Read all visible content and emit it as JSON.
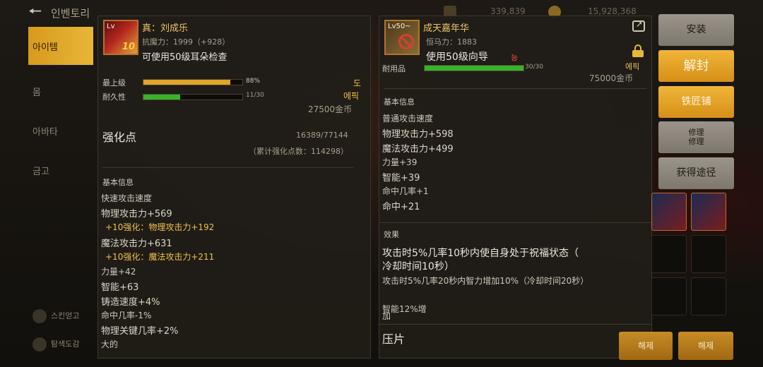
{
  "topbar": {
    "title": "인벤토리",
    "currency_1": "339,839",
    "currency_2": "15,928,368"
  },
  "nav": {
    "items": [
      "아이템",
      "몸",
      "아바타",
      "금고"
    ],
    "bottom_1": "스킨얻고",
    "bottom_2": "탐색도감"
  },
  "left_panel": {
    "item_name": "真：刘成乐",
    "item_level": "Lv",
    "item_plus": "10",
    "magic_resist": "抗魔力：1999（+928）",
    "usage": "可使用50级耳朵检查",
    "grade_label": "最上级",
    "grade_percent": "88%",
    "grade_fill": 0.88,
    "grade_right": "도",
    "durability_label": "耐久性",
    "durability_value": "11/30",
    "durability_fill": 0.37,
    "rarity": "에픽",
    "price": "27500金币",
    "enhance_label": "强化点",
    "enhance_value": "16389/77144",
    "enhance_total": "（累计强化点数：114298）",
    "basic_info_title": "基本信息",
    "stats": [
      {
        "text": "快速攻击速度",
        "cls": "stat-s"
      },
      {
        "text": "物理攻击力+569",
        "cls": "stat"
      },
      {
        "text": "+10强化：物理攻击力+192",
        "cls": "stat-s gold"
      },
      {
        "text": "魔法攻击力+631",
        "cls": "stat"
      },
      {
        "text": "+10强化：魔法攻击力+211",
        "cls": "stat-s gold"
      },
      {
        "text": "力量+42",
        "cls": "stat-s"
      },
      {
        "text": "智能+63",
        "cls": "stat"
      },
      {
        "text": "铸造速度+4%",
        "cls": "stat"
      },
      {
        "text": "命中几率-1%",
        "cls": "stat-s"
      },
      {
        "text": "物理关键几率+2%",
        "cls": "stat"
      },
      {
        "text": "大的",
        "cls": "stat-s"
      }
    ]
  },
  "right_panel": {
    "item_name": "成天嘉年华",
    "item_level": "Lv50~",
    "magic_power": "恒马力：1883",
    "usage": "使用50级向导",
    "usage_tag": "능",
    "category": "耐用品",
    "durability_value": "30/30",
    "durability_fill": 1.0,
    "rarity": "에픽",
    "price": "75000金币",
    "basic_info_title": "基本信息",
    "stats": [
      {
        "text": "普通攻击速度",
        "cls": "stat-s"
      },
      {
        "text": "物理攻击力+598",
        "cls": "stat"
      },
      {
        "text": "魔法攻击力+499",
        "cls": "stat"
      },
      {
        "text": "力量+39",
        "cls": "stat-s"
      },
      {
        "text": "智能+39",
        "cls": "stat"
      },
      {
        "text": "命中几率+1",
        "cls": "stat-s"
      },
      {
        "text": "命中+21",
        "cls": "stat"
      }
    ],
    "effect_title": "效果",
    "effect_1": "攻击时5%几率10秒内使自身处于祝福状态（",
    "effect_1b": "冷却时间10秒）",
    "effect_2": "攻击时5%几率20秒内智力增加10%（冷却时间20秒）",
    "effect_3": "智能12%增",
    "effect_3b": "加",
    "bottom_label": "压片"
  },
  "buttons": {
    "install": "安装",
    "unseal": "解封",
    "blacksmith": "铁匠铺",
    "repair_1": "修理",
    "repair_2": "修理",
    "obtain": "获得途径"
  },
  "bottom_buttons": {
    "left": "해제",
    "right": "해제"
  },
  "colors": {
    "accent_gold": "#e9b63a",
    "grade_bar": "#e2a52a",
    "durability_bar": "#38b42a",
    "rarity": "#f2c048"
  }
}
